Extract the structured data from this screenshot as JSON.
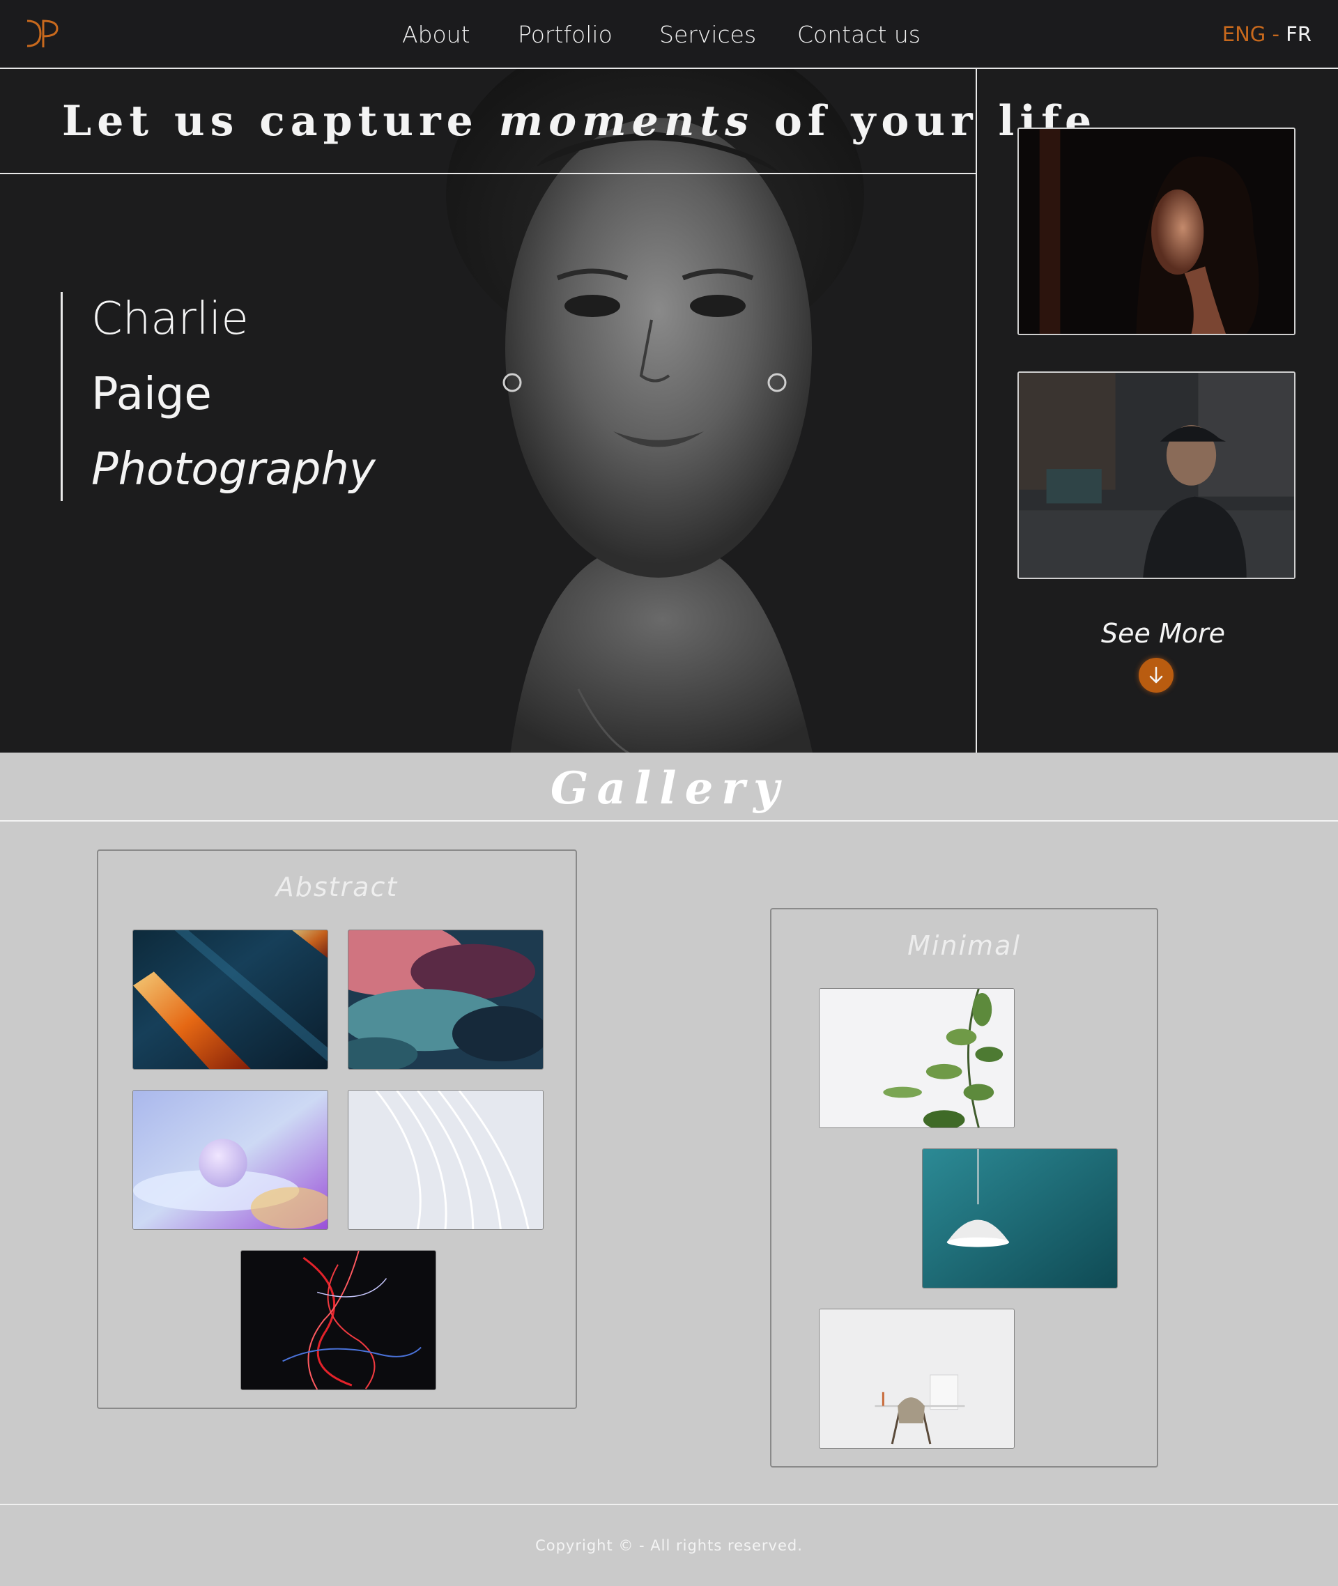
{
  "nav": {
    "items": [
      "About",
      "Portfolio",
      "Services",
      "Contact us"
    ],
    "lang_active": "ENG",
    "lang_separator": "-",
    "lang_other": "FR"
  },
  "hero": {
    "tagline_pre": "Let us capture",
    "tagline_em": "moments",
    "tagline_post": "of your life",
    "name_first": "Charlie",
    "name_last": "Paige",
    "name_sub": "Photography",
    "see_more": "See More"
  },
  "gallery": {
    "title": "Gallery",
    "abstract_title": "Abstract",
    "minimal_title": "Minimal"
  },
  "footer": {
    "copyright": "Copyright © - All rights reserved."
  },
  "colors": {
    "accent": "#c8691d",
    "dark_bg": "#1c1c1d",
    "gallery_bg": "#cacaca"
  },
  "icons": {
    "logo": "dp-monogram-logo",
    "see_more": "arrow-down-icon"
  }
}
